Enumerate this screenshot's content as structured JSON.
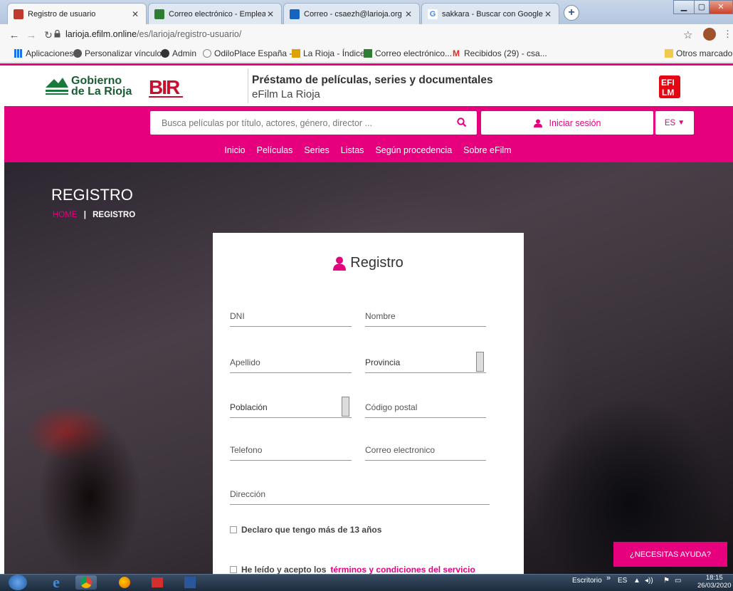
{
  "browser": {
    "tabs": [
      {
        "title": "Registro de usuario"
      },
      {
        "title": "Correo electrónico - Empleados"
      },
      {
        "title": "Correo - csaezh@larioja.org"
      },
      {
        "title": "sakkara - Buscar con Google"
      }
    ],
    "url_host": "larioja.efilm.online",
    "url_path": "/es/larioja/registro-usuario/",
    "bookmarks": [
      {
        "label": "Aplicaciones"
      },
      {
        "label": "Personalizar vínculos"
      },
      {
        "label": "Admin"
      },
      {
        "label": "OdiloPlace España -..."
      },
      {
        "label": "La Rioja - Índice"
      },
      {
        "label": "Correo electrónico..."
      },
      {
        "label": "Recibidos (29) - csa..."
      }
    ],
    "other_bookmarks": "Otros marcadores"
  },
  "site": {
    "logo_line1": "Gobierno",
    "logo_line2": "de La Rioja",
    "title": "Préstamo de películas, series y documentales",
    "subtitle": "eFilm La Rioja",
    "search_placeholder": "Busca películas por título, actores, género, director ...",
    "login_label": "Iniciar sesión",
    "lang": "ES",
    "nav": [
      "Inicio",
      "Películas",
      "Series",
      "Listas",
      "Según procedencia",
      "Sobre eFilm"
    ],
    "brand_color": "#e6007e"
  },
  "page": {
    "heading": "REGISTRO",
    "breadcrumb_home": "HOME",
    "breadcrumb_sep": "|",
    "breadcrumb_current": "REGISTRO"
  },
  "form": {
    "title": "Registro",
    "fields": {
      "dni": "DNI",
      "nombre": "Nombre",
      "apellido": "Apellido",
      "provincia": "Provincia",
      "poblacion": "Población",
      "codigo_postal": "Código postal",
      "telefono": "Telefono",
      "correo": "Correo electronico",
      "direccion": "Dirección"
    },
    "age_check": "Declaro que tengo más de 13 años",
    "terms_prefix": "He leído y acepto los",
    "terms_link": "términos y condiciones del servicio"
  },
  "help_button": "¿NECESITAS AYUDA?",
  "taskbar": {
    "desktop_label": "Escritorio",
    "lang": "ES",
    "time": "18:15",
    "date": "26/03/2020"
  }
}
